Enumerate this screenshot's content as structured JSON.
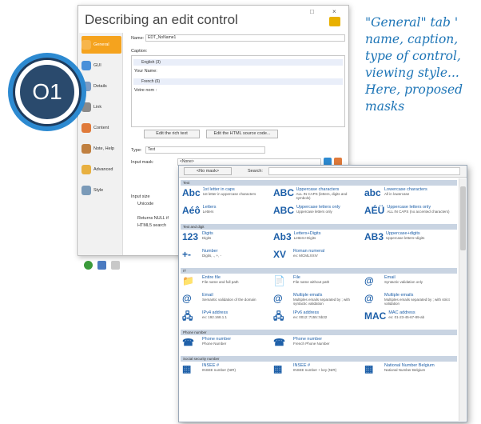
{
  "window": {
    "title": "Describing an edit control",
    "restore_glyph": "□",
    "close_glyph": "×"
  },
  "sidebar": {
    "items": [
      {
        "label": "General",
        "icon": "gear-icon",
        "color": "#f5a31e"
      },
      {
        "label": "GUI",
        "icon": "gui-icon",
        "color": "#4a90d9"
      },
      {
        "label": "Details",
        "icon": "details-icon",
        "color": "#7b9cc4"
      },
      {
        "label": "Link",
        "icon": "link-icon",
        "color": "#8a8a8a"
      },
      {
        "label": "Content",
        "icon": "content-icon",
        "color": "#e07a3a"
      },
      {
        "label": "Note, Help",
        "icon": "help-icon",
        "color": "#c08040"
      },
      {
        "label": "Advanced",
        "icon": "advanced-icon",
        "color": "#e8b040"
      },
      {
        "label": "Style",
        "icon": "style-icon",
        "color": "#7a9ab8"
      }
    ]
  },
  "form": {
    "name_label": "Name:",
    "name_value": "EDT_NoName1",
    "caption_label": "Caption:",
    "caption_lang": "English (3)",
    "caption_value": "Your Name:",
    "lang2": "French (6)",
    "lang2_value": "Votre nom :",
    "edit_rich_text": "Edit the rich text",
    "edit_html": "Edit the HTML source code...",
    "type_label": "Type:",
    "type_value": "Text",
    "mask_label": "Input mask:",
    "mask_value": "<None>",
    "input_size_label": "Input size",
    "unicode_label": "Unicode",
    "null_label": "Returns NULL if",
    "html5_label": "HTML5 search"
  },
  "badge": {
    "label": "O1"
  },
  "note": {
    "text": "\"General\" tab '\nname, caption,\ntype of control,\nviewing style...\nHere, proposed\nmasks"
  },
  "popup": {
    "no_mask_label": "<No mask>",
    "search_label": "Search:",
    "sections": [
      {
        "title": "Text",
        "cells": [
          {
            "icon": "Abc",
            "title": "1st letter in caps",
            "sub": "1st letter in uppercase characters"
          },
          {
            "icon": "ABC",
            "title": "Uppercase characters",
            "sub": "ALL IN CAPS (letters, digits and symbols)"
          },
          {
            "icon": "abc",
            "title": "Lowercase characters",
            "sub": "All in lowercase"
          },
          {
            "icon": "Aéô",
            "title": "Letters",
            "sub": "Letters"
          },
          {
            "icon": "ABC",
            "title": "Uppercase letters only",
            "sub": "Uppercase letters only"
          },
          {
            "icon": "AÉÜ",
            "title": "Uppercase letters only",
            "sub": "ALL IN CAPS (no accented characters)"
          }
        ]
      },
      {
        "title": "Text and digit",
        "cells": [
          {
            "icon": "123",
            "title": "Digits",
            "sub": "Digits"
          },
          {
            "icon": "Ab3",
            "title": "Letters+Digits",
            "sub": "Letters+Digits"
          },
          {
            "icon": "AB3",
            "title": "Uppercase+digits",
            "sub": "Uppercase letters+digits"
          },
          {
            "icon": "+-",
            "title": "Number",
            "sub": "Digits, ., +, -"
          },
          {
            "icon": "XV",
            "title": "Roman numeral",
            "sub": "ex: MCMLXXIV"
          }
        ]
      },
      {
        "title": "IT",
        "cells": [
          {
            "icon": "📁",
            "title": "Entire file",
            "sub": "File name and full path"
          },
          {
            "icon": "📄",
            "title": "File",
            "sub": "File name without path"
          },
          {
            "icon": "@",
            "title": "Email",
            "sub": "Syntactic validation only"
          },
          {
            "icon": "@",
            "title": "Email",
            "sub": "Semantic validation of the domain"
          },
          {
            "icon": "@",
            "title": "Multiple emails",
            "sub": "Multiples emails separated by ; with syntactic validation"
          },
          {
            "icon": "@",
            "title": "Multiple emails",
            "sub": "Multiples emails separated by ; with strict validation"
          },
          {
            "icon": "🖧",
            "title": "IPv4 address",
            "sub": "ex: 192.168.1.1"
          },
          {
            "icon": "🖧",
            "title": "IPv6 address",
            "sub": "ex: 0012::7155::5b32"
          },
          {
            "icon": "MAC",
            "title": "MAC address",
            "sub": "ex: 01-23-45-67-89-ab"
          }
        ]
      },
      {
        "title": "Phone number",
        "cells": [
          {
            "icon": "☎",
            "title": "Phone number",
            "sub": "Phone Number"
          },
          {
            "icon": "☎",
            "title": "Phone number",
            "sub": "French Phone Number"
          }
        ]
      },
      {
        "title": "Social security number",
        "cells": [
          {
            "icon": "▦",
            "title": "INSEE #",
            "sub": "INSEE number (NIR)"
          },
          {
            "icon": "▦",
            "title": "INSEE #",
            "sub": "INSEE number + key (NIR)"
          },
          {
            "icon": "▦",
            "title": "National Number Belgium",
            "sub": "National Number Belgium"
          }
        ]
      }
    ]
  }
}
